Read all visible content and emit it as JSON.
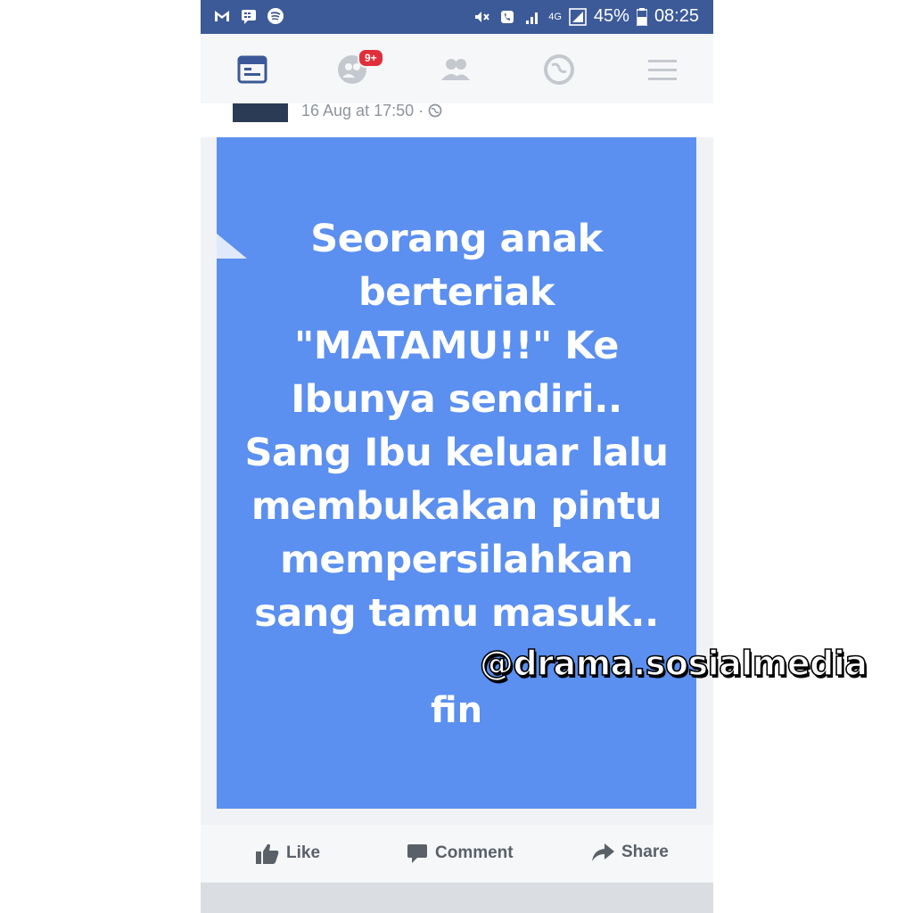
{
  "status_bar": {
    "battery": "45%",
    "time": "08:25",
    "network": "4G",
    "icons_left": [
      "gmail-m-icon",
      "blackberry-messenger-icon",
      "spotify-icon"
    ],
    "icons_right": [
      "mute-icon",
      "phone-icon",
      "signal-icon",
      "data-signal-icon",
      "battery-icon"
    ]
  },
  "nav": {
    "items": [
      "news-feed-icon",
      "friend-requests-icon",
      "friends-icon",
      "notifications-globe-icon",
      "menu-icon"
    ],
    "badge": "9+"
  },
  "post": {
    "time": "16 Aug at 17:50 ·",
    "privacy_icon": "globe-icon",
    "text_lines": [
      "Seorang anak",
      "berteriak",
      "\"MATAMU!!\" Ke",
      "Ibunya sendiri..",
      "Sang Ibu keluar lalu",
      "membukakan pintu",
      "mempersilahkan",
      "sang tamu masuk.."
    ],
    "end": "fin",
    "background_color": "#5b8ff0"
  },
  "actions": {
    "like": "Like",
    "comment": "Comment",
    "share": "Share"
  },
  "watermark": "@drama.sosialmedia",
  "colors": {
    "status_bar": "#3c5a98",
    "nav_icon_active": "#3b5998",
    "nav_icon_inactive": "#c4c8cf",
    "badge": "#e02f3a"
  }
}
